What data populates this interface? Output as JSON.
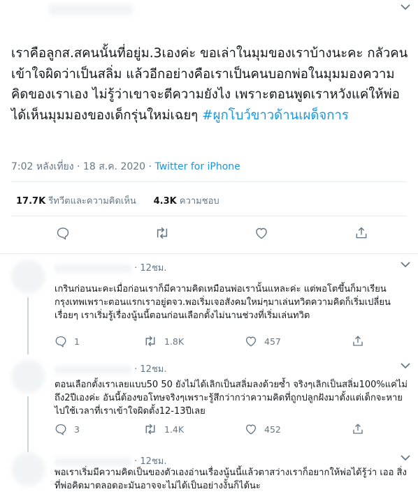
{
  "tweet": {
    "text": "เราคือลูกส.สคนนั้นที่อยู่ม.3เองค่ะ ขอเล่าในมุมของเราบ้างนะคะ กลัวคนเข้าใจผิดว่าเป็นสลิ่ม แล้วอีกอย่างคือเราเป็นคนบอกพ่อในมุมมองความคิดของเราเอง ไม่รู้ว่าเขาจะตีความยังไง เพราะตอนพูดเราหวังแค่ให้พ่อได้เห็นมุมมองของเด็กรุ่นใหม่เฉยๆ ",
    "hashtag": "#ผูกโบว์ขาวด้านเผด็จการ",
    "time": "7:02 หลังเที่ยง · 18 ส.ค. 2020 · ",
    "source": "Twitter for iPhone",
    "retweets_count": "17.7K",
    "retweets_label": "รีทวีตและความคิดเห็น",
    "likes_count": "4.3K",
    "likes_label": "ความชอบ"
  },
  "replies": [
    {
      "time": "· 12ชม.",
      "text": "เกรินก่อนนะคะเมื่อก่อนเราก็มีความคิดเหมือนพ่อเรานั้นแหละค่ะ แต่พอโตขึ้นก็มาเรียนกรุงเทพเพราะตอนแรกเราอยู่ตจว.พอเริ่มเจอสังคมใหม่ๆมาเล่นทวิตความคิดก็เริ่มเปลี่ยนเรื่อยๆ เราเริ่มรู้เรื่องนู้นนี้ตอนก่อนเลือกตั้งไม่นานช่วงที่เริ่มเล่นทวิต",
      "replies": "1",
      "retweets": "1.8K",
      "likes": "457"
    },
    {
      "time": "· 12ชม.",
      "text": "ตอนเลือกตั้งเราเลยแบบ50 50 ยังไม่ได้เลิกเป็นสลิ่มลงด้วยซ้ำ จริงๆเลิกเป็นสลิ่ม100%แค่ไม่ถึง2ปีเองค่ะ อันนี้ต้องขอโทษจริงๆเพราะรู้สึกว่ากว่าความคิดที่ถูกปลูกฝังมาตั้งแต่เด็กจะหายไปใช้เวลาที่เราเข้าใจผิดตั้ง12-13ปีเลย",
      "replies": "3",
      "retweets": "1.4K",
      "likes": "452"
    },
    {
      "time": "· 12ชม.",
      "text": "พอเราเริ่มมีความคิดเป็นของตัวเองอ่านเรื่องนู้นนี้แล้วตาสว่างเราก็อยากให้พ่อได้รู้ว่า เออ สิ่งที่พ่อคิดมาตลอดอะมันอาจจะไม่ได้เป็นอย่างงั้นก็ได้นะ",
      "replies": "",
      "retweets": "",
      "likes": ""
    }
  ]
}
